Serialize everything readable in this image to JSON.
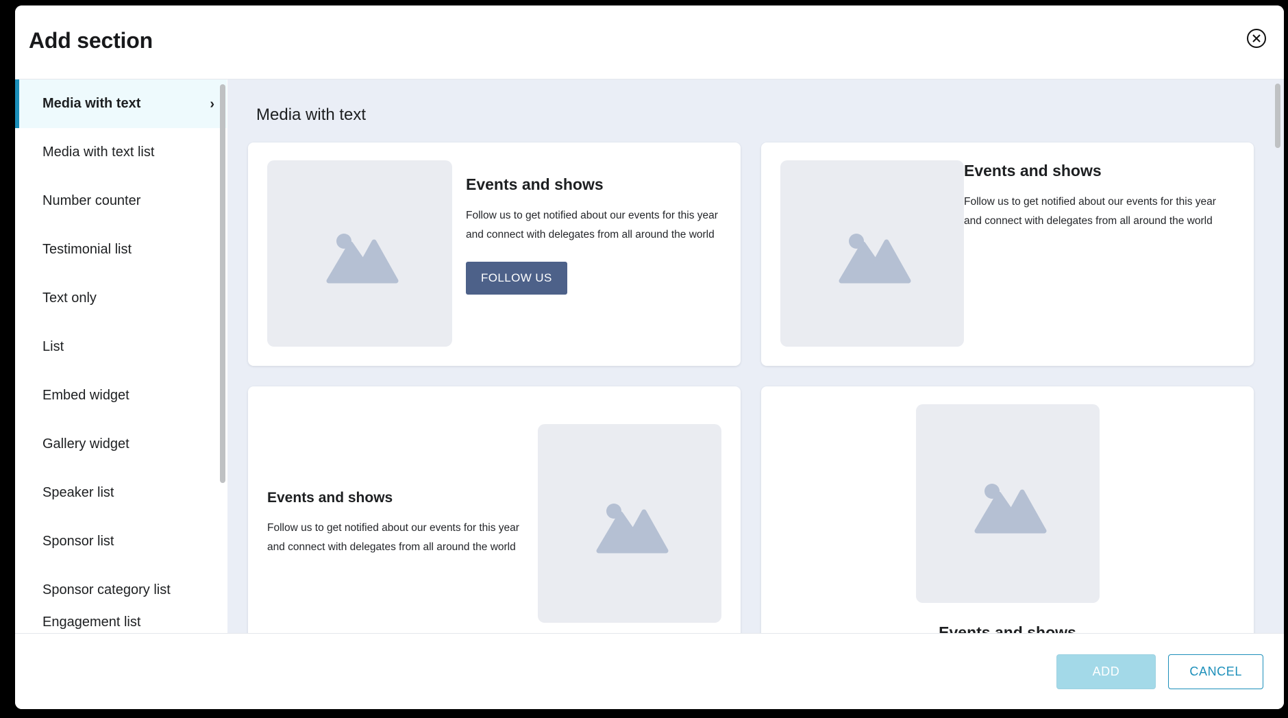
{
  "modal": {
    "title": "Add section",
    "close_icon": "close-circle-icon"
  },
  "sidebar": {
    "items": [
      {
        "label": "Media with text",
        "active": true,
        "chevron": "›"
      },
      {
        "label": "Media with text list",
        "active": false
      },
      {
        "label": "Number counter",
        "active": false
      },
      {
        "label": "Testimonial list",
        "active": false
      },
      {
        "label": "Text only",
        "active": false
      },
      {
        "label": "List",
        "active": false
      },
      {
        "label": "Embed widget",
        "active": false
      },
      {
        "label": "Gallery widget",
        "active": false
      },
      {
        "label": "Speaker list",
        "active": false
      },
      {
        "label": "Sponsor list",
        "active": false
      },
      {
        "label": "Sponsor category list",
        "active": false
      },
      {
        "label": "Engagement list",
        "active": false,
        "partial": true
      }
    ]
  },
  "content": {
    "heading": "Media with text",
    "cards": [
      {
        "layout": "image-left-with-button",
        "title": "Events and shows",
        "description": "Follow us to get notified about our events for this year and connect with delegates from all around the world",
        "button_label": "FOLLOW US",
        "image_icon": "image-placeholder-icon"
      },
      {
        "layout": "image-left-no-button",
        "title": "Events and shows",
        "description": "Follow us to get notified about our events for this year and connect with delegates from all around the world",
        "image_icon": "image-placeholder-icon"
      },
      {
        "layout": "image-right",
        "title": "Events and shows",
        "description": "Follow us to get notified about our events for this year and connect with delegates from all around the world",
        "image_icon": "image-placeholder-icon"
      },
      {
        "layout": "image-top-centered",
        "title": "Events and shows",
        "image_icon": "image-placeholder-icon"
      }
    ]
  },
  "footer": {
    "add_label": "ADD",
    "cancel_label": "CANCEL"
  },
  "colors": {
    "accent": "#1c8fba",
    "active_item_bg": "#eefafd",
    "content_bg": "#eaeef6",
    "card_bg": "#ffffff",
    "image_placeholder_bg": "#eaecf1",
    "image_placeholder_icon": "#b5c0d3",
    "follow_button_bg": "#4d6189",
    "add_button_bg": "#a3d9e8"
  }
}
